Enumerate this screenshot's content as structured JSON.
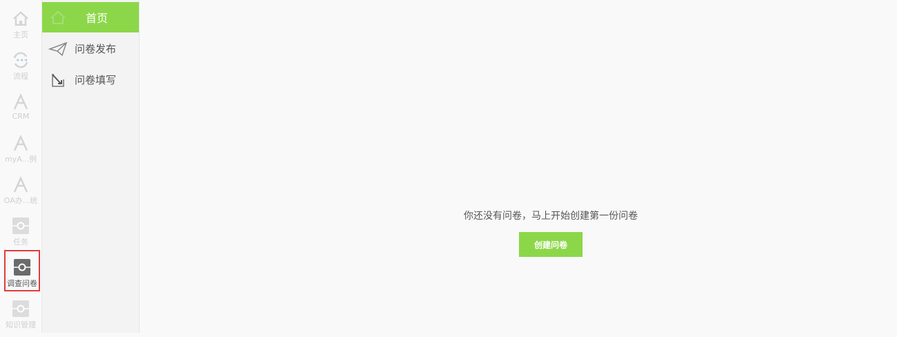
{
  "rail": {
    "items": [
      {
        "label": "主页",
        "icon": "home-icon"
      },
      {
        "label": "流程",
        "icon": "process-icon"
      },
      {
        "label": "CRM",
        "icon": "app-icon"
      },
      {
        "label": "myA...例",
        "icon": "app-icon"
      },
      {
        "label": "OA办...统",
        "icon": "app-icon"
      },
      {
        "label": "任务",
        "icon": "module-icon"
      },
      {
        "label": "调查问卷",
        "icon": "module-icon",
        "active": true
      },
      {
        "label": "知识管理",
        "icon": "module-icon"
      }
    ]
  },
  "subnav": {
    "items": [
      {
        "label": "首页",
        "icon": "home-icon",
        "active": true
      },
      {
        "label": "问卷发布",
        "icon": "paper-plane-icon"
      },
      {
        "label": "问卷填写",
        "icon": "edit-icon"
      }
    ]
  },
  "main": {
    "empty_message": "你还没有问卷，马上开始创建第一份问卷",
    "create_button": "创建问卷"
  },
  "colors": {
    "accent": "#8cd749",
    "highlight_border": "#e23b3b"
  }
}
